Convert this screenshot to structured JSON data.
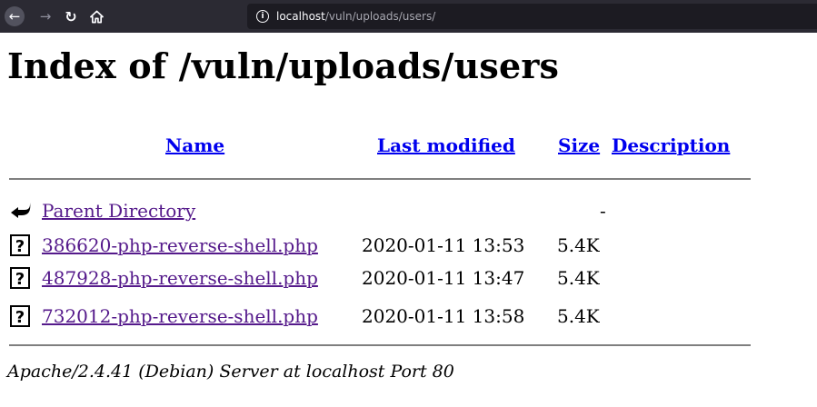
{
  "browser": {
    "back_icon": "back-arrow-icon",
    "forward_icon": "forward-arrow-icon",
    "reload_icon": "reload-icon",
    "home_icon": "home-icon",
    "url_host": "localhost",
    "url_path": "/vuln/uploads/users/"
  },
  "page": {
    "title": "Index of /vuln/uploads/users",
    "columns": {
      "name": "Name",
      "last_modified": "Last modified",
      "size": "Size",
      "description": "Description"
    },
    "parent": {
      "label": "Parent Directory",
      "size": "-",
      "icon": "back-folder-icon"
    },
    "files": [
      {
        "name": "386620-php-reverse-shell.php",
        "modified": "2020-01-11 13:53",
        "size": "5.4K",
        "icon": "unknown-file-icon"
      },
      {
        "name": "487928-php-reverse-shell.php",
        "modified": "2020-01-11 13:47",
        "size": "5.4K",
        "icon": "unknown-file-icon"
      },
      {
        "name": "732012-php-reverse-shell.php",
        "modified": "2020-01-11 13:58",
        "size": "5.4K",
        "icon": "unknown-file-icon"
      }
    ],
    "footer": "Apache/2.4.41 (Debian) Server at localhost Port 80"
  }
}
